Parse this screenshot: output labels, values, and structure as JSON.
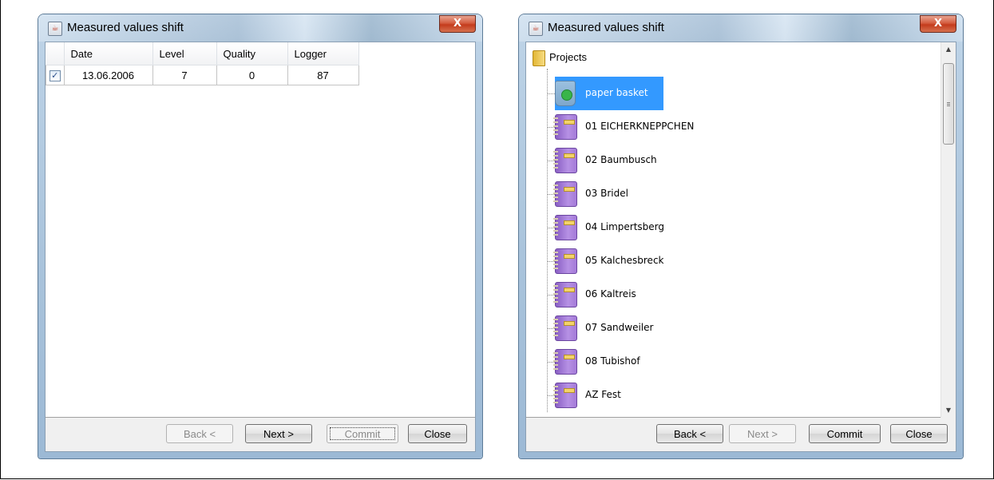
{
  "left_window": {
    "title": "Measured values shift",
    "close_glyph": "X",
    "table": {
      "columns": [
        "Date",
        "Level",
        "Quality",
        "Logger"
      ],
      "rows": [
        {
          "checked": true,
          "check_glyph": "✓",
          "date": "13.06.2006",
          "level": "7",
          "quality": "0",
          "logger": "87"
        }
      ]
    },
    "buttons": {
      "back": "Back <",
      "next": "Next >",
      "commit": "Commit",
      "close": "Close"
    }
  },
  "right_window": {
    "title": "Measured values shift",
    "close_glyph": "X",
    "tree": {
      "root": "Projects",
      "items": [
        {
          "label": "paper basket",
          "icon": "recycle-bin-icon",
          "selected": true
        },
        {
          "label": "01 EICHERKNEPPCHEN",
          "icon": "notebook-icon"
        },
        {
          "label": "02 Baumbusch",
          "icon": "notebook-icon"
        },
        {
          "label": "03 Bridel",
          "icon": "notebook-icon"
        },
        {
          "label": "04 Limpertsberg",
          "icon": "notebook-icon"
        },
        {
          "label": "05 Kalchesbreck",
          "icon": "notebook-icon"
        },
        {
          "label": "06 Kaltreis",
          "icon": "notebook-icon"
        },
        {
          "label": "07 Sandweiler",
          "icon": "notebook-icon"
        },
        {
          "label": "08 Tubishof",
          "icon": "notebook-icon"
        },
        {
          "label": "AZ Fest",
          "icon": "notebook-icon"
        }
      ]
    },
    "buttons": {
      "back": "Back <",
      "next": "Next >",
      "commit": "Commit",
      "close": "Close"
    },
    "scrollbar": {
      "up_glyph": "▲",
      "down_glyph": "▼"
    }
  },
  "colors": {
    "selection": "#3399ff",
    "close_button": "#c43b1c",
    "notebook": "#a47ad8"
  }
}
